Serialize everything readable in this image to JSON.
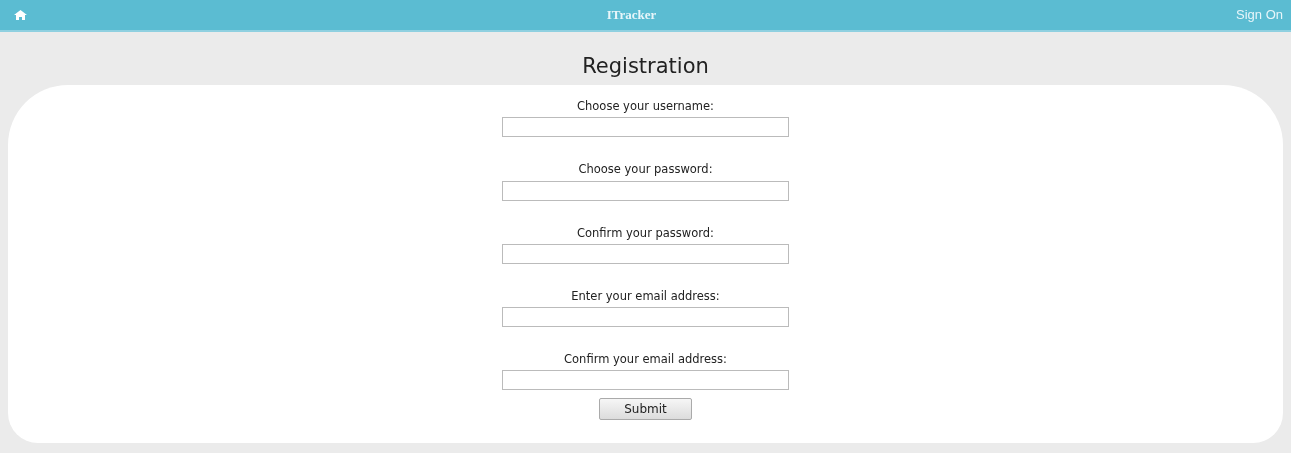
{
  "navbar": {
    "brand": "ITracker",
    "sign_on": "Sign On"
  },
  "title": "Registration",
  "fields": [
    {
      "label": "Choose your username:"
    },
    {
      "label": "Choose your password:"
    },
    {
      "label": "Confirm your password:"
    },
    {
      "label": "Enter your email address:"
    },
    {
      "label": "Confirm your email address:"
    }
  ],
  "submit": "Submit"
}
